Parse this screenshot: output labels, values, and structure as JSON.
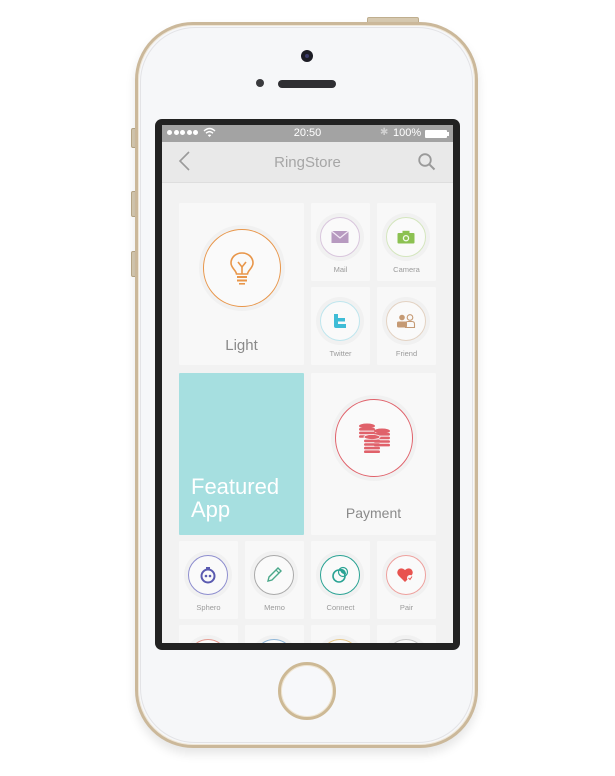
{
  "status_bar": {
    "time": "20:50",
    "battery": "100%",
    "signal_icon": "signal-dots-icon",
    "wifi_icon": "wifi-icon",
    "bluetooth_icon": "bluetooth-icon"
  },
  "nav": {
    "title": "RingStore",
    "back_icon": "chevron-left-icon",
    "search_icon": "search-icon"
  },
  "tiles": {
    "light": {
      "label": "Light",
      "icon": "lightbulb-icon",
      "color": "#e8964a"
    },
    "mail": {
      "label": "Mail",
      "icon": "envelope-icon",
      "color": "#b79ac0"
    },
    "camera": {
      "label": "Camera",
      "icon": "camera-icon",
      "color": "#8cc152"
    },
    "twitter": {
      "label": "Twitter",
      "icon": "twitter-icon",
      "color": "#3fbcd6"
    },
    "friend": {
      "label": "Friend",
      "icon": "people-icon",
      "color": "#c59a74"
    },
    "featured": {
      "line1": "Featured",
      "line2": "App",
      "color": "#a6dfe0"
    },
    "payment": {
      "label": "Payment",
      "icon": "coins-icon",
      "color": "#e0616a"
    },
    "sphero": {
      "label": "Sphero",
      "icon": "sphero-icon",
      "color": "#5a5ab0"
    },
    "memo": {
      "label": "Memo",
      "icon": "pencil-icon",
      "color": "#4aa88a"
    },
    "connect": {
      "label": "Connect",
      "icon": "connect-icon",
      "color": "#2aa394"
    },
    "pair": {
      "label": "Pair",
      "icon": "heart-icon",
      "color": "#e8534f"
    }
  },
  "partial_row_colors": [
    "#e59a90",
    "#8fb6d8",
    "#e8c888",
    "#c8c8c8"
  ]
}
